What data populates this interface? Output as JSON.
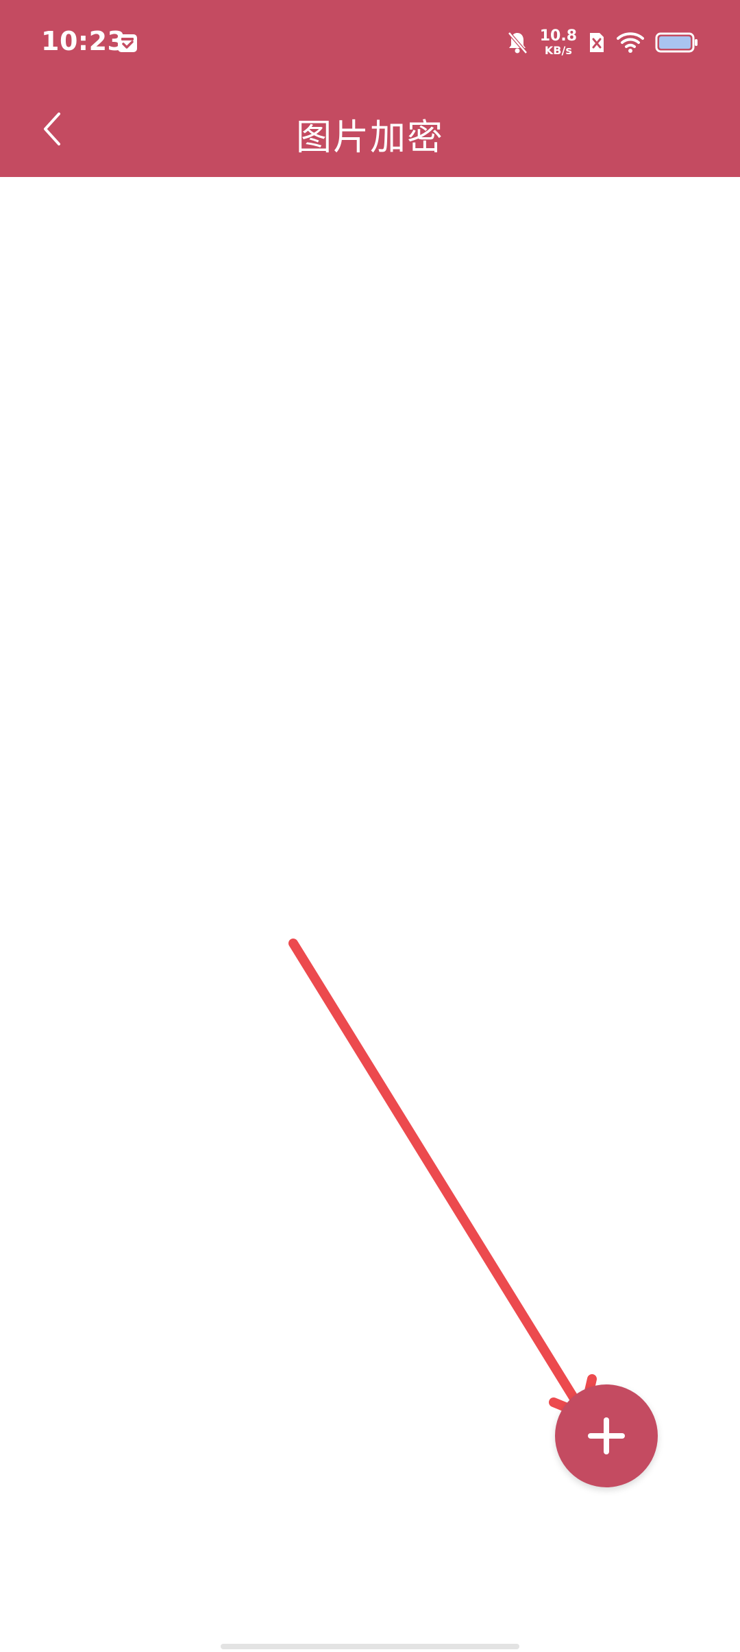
{
  "status_bar": {
    "time": "10:23",
    "net_speed_value": "10.8",
    "net_speed_unit": "KB/s",
    "icons": [
      "calendar-icon",
      "bell-off-icon",
      "sim-off-icon",
      "wifi-icon",
      "battery-icon"
    ]
  },
  "app_bar": {
    "title": "图片加密",
    "back_icon": "chevron-left-icon"
  },
  "fab": {
    "icon": "plus-icon"
  },
  "colors": {
    "brand": "#c44b61",
    "annotation": "#ec4a4e",
    "background": "#ffffff"
  }
}
